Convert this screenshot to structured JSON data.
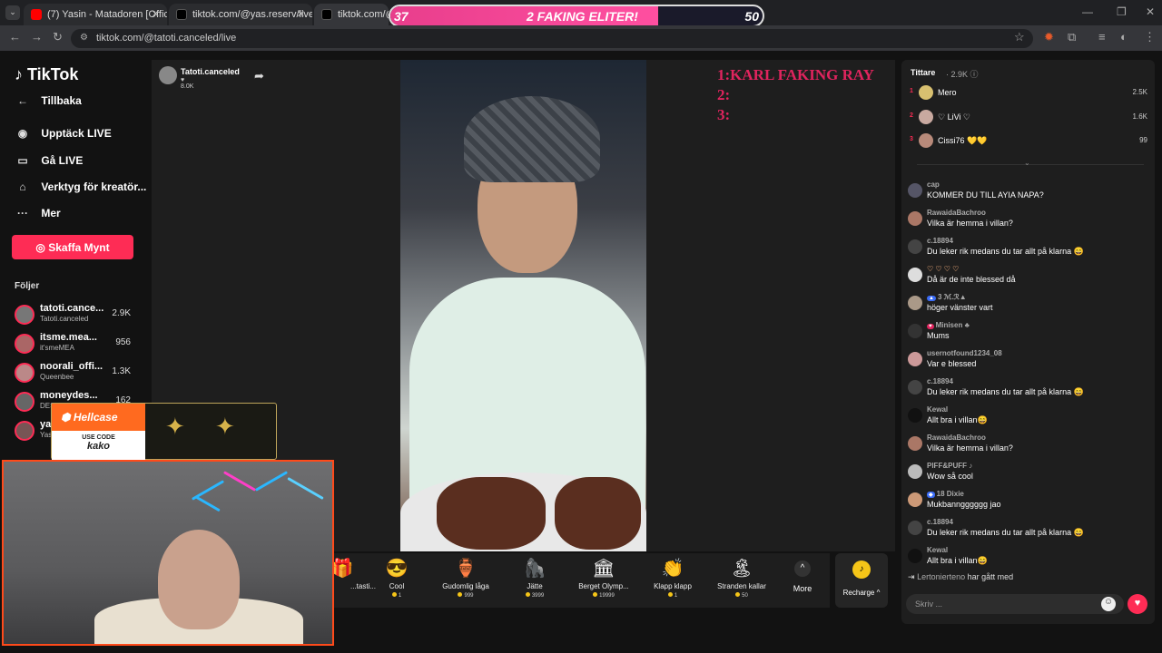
{
  "browser": {
    "tabs": [
      {
        "title": "(7) Yasin - Matadoren [Official V",
        "close": "✕"
      },
      {
        "title": "tiktok.com/@yas.reserv/live",
        "close": "✕"
      },
      {
        "title": "tiktok.com/@tato",
        "close": ""
      }
    ],
    "url": "tiktok.com/@tatoti.canceled/live"
  },
  "scorebar": {
    "left": "37",
    "center": "2 FAKING ELITER!",
    "right": "50",
    "fill_fraction": 0.72
  },
  "sidebar": {
    "logo": "TikTok",
    "nav": [
      {
        "label": "Tillbaka",
        "icon": "←"
      },
      {
        "label": "Upptäck LIVE",
        "icon": "◉"
      },
      {
        "label": "Gå LIVE",
        "icon": "▭"
      },
      {
        "label": "Verktyg för kreatör...",
        "icon": "⌂"
      },
      {
        "label": "Mer",
        "icon": "···"
      }
    ],
    "coin_button": "Skaffa Mynt",
    "following_title": "Följer",
    "following": [
      {
        "name": "tatoti.cance...",
        "sub": "Tatoti.canceled",
        "count": "2.9K"
      },
      {
        "name": "itsme.mea...",
        "sub": "it'smeMEA",
        "count": "956"
      },
      {
        "name": "noorali_offi...",
        "sub": "Queenbee",
        "count": "1.3K"
      },
      {
        "name": "moneydes...",
        "sub": "DES",
        "count": "162"
      },
      {
        "name": "ya",
        "sub": "Yas",
        "count": ""
      }
    ]
  },
  "stream": {
    "streamer_name": "Tatoti.canceled",
    "likes": "♥ 8.0K",
    "overlay_lines": [
      "1:KARL FAKING RAY",
      "2:",
      "3:"
    ]
  },
  "gifts": [
    {
      "name": "...tasti...",
      "price": "",
      "icon": "🎁"
    },
    {
      "name": "Cool",
      "price": "1",
      "icon": "😎"
    },
    {
      "name": "Gudomlig låga",
      "price": "999",
      "icon": "🏺"
    },
    {
      "name": "Jätte",
      "price": "3999",
      "icon": "🦍"
    },
    {
      "name": "Berget Olymp...",
      "price": "19999",
      "icon": "🏛"
    },
    {
      "name": "Klapp klapp",
      "price": "1",
      "icon": "👏"
    },
    {
      "name": "Stranden kallar",
      "price": "50",
      "icon": "🏝"
    }
  ],
  "more_label": "More",
  "recharge_label": "Recharge ^",
  "viewers": {
    "title": "Tittare",
    "count": "· 2.9K ⓘ",
    "top": [
      {
        "rank": "1",
        "name": "Mero",
        "score": "2.5K"
      },
      {
        "rank": "2",
        "name": "♡ LiVi ♡",
        "score": "1.6K"
      },
      {
        "rank": "3",
        "name": "Cissi76 💛💛",
        "score": "99"
      }
    ]
  },
  "chat": [
    {
      "user": "cap",
      "text": "KOMMER DU TILL AYIA NAPA?"
    },
    {
      "user": "RawaidaBachroo",
      "text": "Vilka är hemma i villan?"
    },
    {
      "user": "c.18894",
      "text": "Du leker rik medans du tar allt på klarna 😄"
    },
    {
      "user": "♡ ♡ ♡ ♡",
      "text": "Då är de inte blessed då"
    },
    {
      "user": "3 ℳ.ℛ▲",
      "text": "höger vänster vart"
    },
    {
      "user": "Minisen ♣",
      "text": "Mums"
    },
    {
      "user": "usernotfound1234_08",
      "text": "Var e blessed"
    },
    {
      "user": "c.18894",
      "text": "Du leker rik medans du tar allt på klarna 😄"
    },
    {
      "user": "Kewal",
      "text": "Allt bra i villan😄"
    },
    {
      "user": "RawaidaBachroo",
      "text": "Vilka är hemma i villan?"
    },
    {
      "user": "PIFF&PUFF ♪",
      "text": "Wow så cool"
    },
    {
      "user": "18 Dixie",
      "text": "Mukbanngggggg jao"
    },
    {
      "user": "c.18894",
      "text": "Du leker rik medans du tar allt på klarna 😄"
    },
    {
      "user": "Kewal",
      "text": "Allt bra i villan😄"
    }
  ],
  "joined": {
    "user": "Lertonierteno",
    "text": "har gått med"
  },
  "chat_placeholder": "Skriv ...",
  "hellcase": {
    "brand": "Hellcase",
    "code_label": "USE CODE",
    "code": "kako"
  }
}
